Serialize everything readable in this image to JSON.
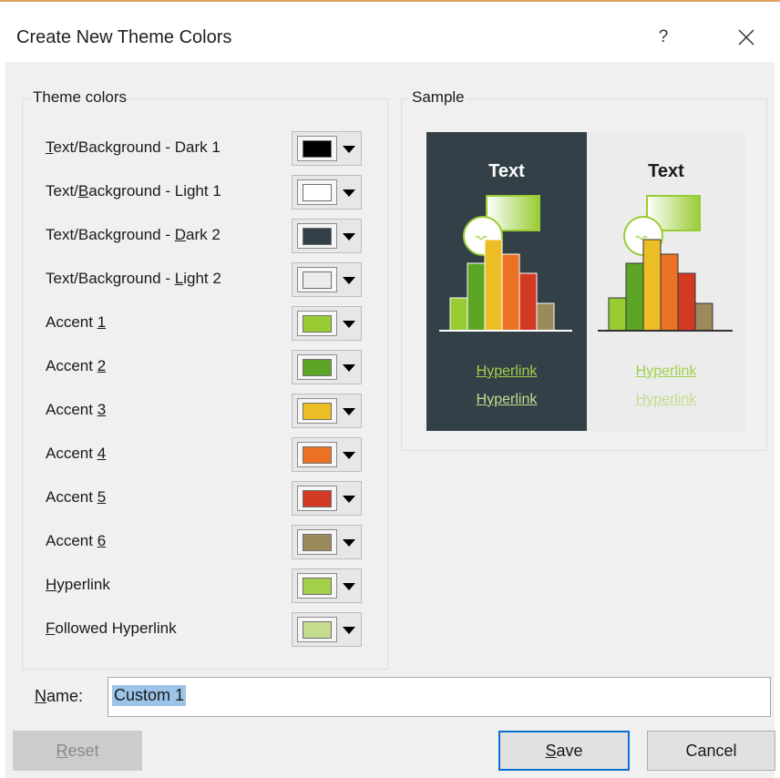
{
  "dialog": {
    "title": "Create New Theme Colors",
    "help_glyph": "?",
    "close_icon": "close-icon"
  },
  "theme_colors": {
    "group_label": "Theme colors",
    "rows": [
      {
        "pre": "",
        "key": "T",
        "post": "ext/Background - Dark 1",
        "color": "#000000"
      },
      {
        "pre": "Text/",
        "key": "B",
        "post": "ackground - Light 1",
        "color": "#ffffff"
      },
      {
        "pre": "Text/Background - ",
        "key": "D",
        "post": "ark 2",
        "color": "#344047"
      },
      {
        "pre": "Text/Background - ",
        "key": "L",
        "post": "ight 2",
        "color": "#ececec"
      },
      {
        "pre": "Accent ",
        "key": "1",
        "post": "",
        "color": "#99cc33"
      },
      {
        "pre": "Accent ",
        "key": "2",
        "post": "",
        "color": "#5ca526"
      },
      {
        "pre": "Accent ",
        "key": "3",
        "post": "",
        "color": "#ecbd25"
      },
      {
        "pre": "Accent ",
        "key": "4",
        "post": "",
        "color": "#eb7125"
      },
      {
        "pre": "Accent ",
        "key": "5",
        "post": "",
        "color": "#d33a24"
      },
      {
        "pre": "Accent ",
        "key": "6",
        "post": "",
        "color": "#9b8a5c"
      },
      {
        "pre": "",
        "key": "H",
        "post": "yperlink",
        "color": "#a3d04a"
      },
      {
        "pre": "",
        "key": "F",
        "post": "ollowed Hyperlink",
        "color": "#c5dc8f"
      }
    ]
  },
  "sample": {
    "group_label": "Sample",
    "text_label": "Text",
    "hyperlink_label": "Hyperlink",
    "followed_hyperlink_label": "Hyperlink",
    "dark_bg": "#344047",
    "light_bg": "#ececec",
    "bar_heights": [
      0.36,
      0.74,
      1.0,
      0.84,
      0.63,
      0.3
    ],
    "bar_colors": [
      "#99cc33",
      "#5ca526",
      "#ecbd25",
      "#eb7125",
      "#d33a24",
      "#9b8a5c"
    ]
  },
  "name_field": {
    "label_key": "N",
    "label_rest": "ame:",
    "value": "Custom 1"
  },
  "buttons": {
    "reset_key": "R",
    "reset_rest": "eset",
    "save_key": "S",
    "save_rest": "ave",
    "cancel": "Cancel"
  }
}
